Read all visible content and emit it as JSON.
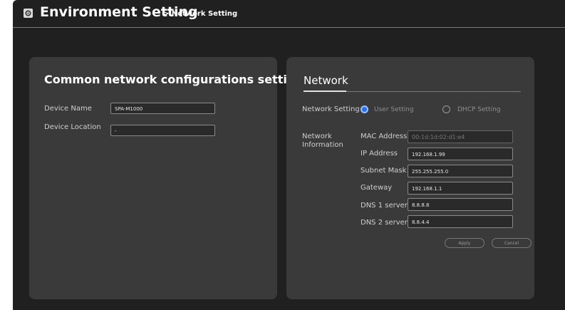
{
  "header": {
    "title": "Environment Setting",
    "subtitle": "> Network Setting",
    "icon": "gear-icon"
  },
  "left_panel": {
    "title": "Common network configurations setting",
    "device_name": {
      "label": "Device Name",
      "value": "SPA-M1000"
    },
    "device_location": {
      "label": "Device Location",
      "value": "-"
    }
  },
  "right_panel": {
    "title": "Network",
    "network_setting": {
      "label": "Network Setting",
      "options": [
        {
          "label": "User Setting",
          "selected": true
        },
        {
          "label": "DHCP Setting",
          "selected": false
        }
      ]
    },
    "network_information": {
      "label_line1": "Network",
      "label_line2": "Information",
      "fields": [
        {
          "label": "MAC Address",
          "value": "00:1d:1d:02:d1:e4",
          "disabled": true
        },
        {
          "label": "IP Address",
          "value": "192.168.1.99"
        },
        {
          "label": "Subnet Mask",
          "value": "255.255.255.0"
        },
        {
          "label": "Gateway",
          "value": "192.168.1.1"
        },
        {
          "label": "DNS 1 server",
          "value": "8.8.8.8"
        },
        {
          "label": "DNS 2 server",
          "value": "8.8.4.4"
        }
      ]
    },
    "buttons": {
      "apply": "Apply",
      "cancel": "Cancel"
    }
  },
  "colors": {
    "background": "#202020",
    "panel": "#3a3a3a",
    "radio_selected": "#2c6fe0"
  }
}
